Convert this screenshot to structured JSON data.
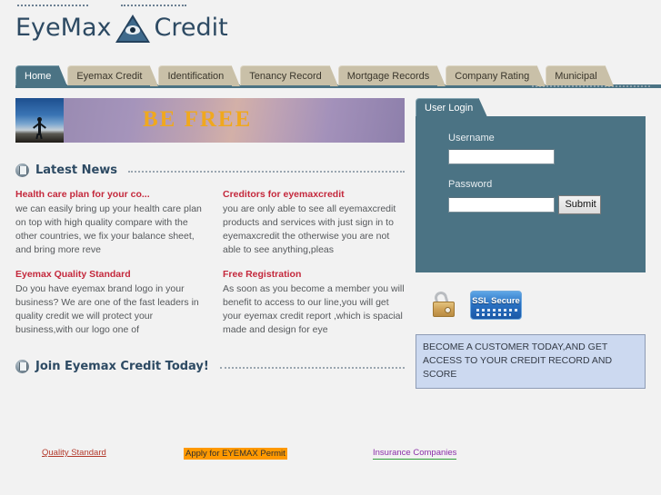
{
  "brand": {
    "word1": "EyeMax",
    "word2": "Credit",
    "logo_icon": "pyramid-eye-icon",
    "logo_color": "#2d4a63"
  },
  "nav": {
    "tabs": [
      {
        "label": "Home",
        "active": true
      },
      {
        "label": "Eyemax Credit",
        "active": false
      },
      {
        "label": "Identification",
        "active": false
      },
      {
        "label": "Tenancy Record",
        "active": false
      },
      {
        "label": "Mortgage Records",
        "active": false
      },
      {
        "label": "Company Rating",
        "active": false
      },
      {
        "label": "Municipal",
        "active": false
      }
    ],
    "active_color": "#4b7384",
    "inactive_color": "#c9c0a8"
  },
  "banner": {
    "text": "BE FREE",
    "text_color": "#f0a81e",
    "photo_alt": "person-arms-raised-silhouette"
  },
  "sections": {
    "latest_news_heading": "Latest News",
    "join_heading": "Join Eyemax Credit Today!"
  },
  "news": [
    {
      "title": "Health care plan for your co...",
      "body": "we can easily bring up your health care plan on top with high quality compare with the other countries, we fix your balance sheet, and bring more reve"
    },
    {
      "title": "Creditors for eyemaxcredit",
      "body": "you are only able to see all eyemaxcredit products and services with just sign in to eyemaxcredit the otherwise you are not able to see anything,pleas"
    },
    {
      "title": "Eyemax Quality Standard",
      "body": "Do you have eyemax brand logo in your business? We are one of the fast leaders in quality credit we will protect your business,with our logo one of"
    },
    {
      "title": "Free Registration",
      "body": "As soon as you become a member you will benefit to access to our line,you will get your eyemax credit report ,which is spacial made and design for eye"
    }
  ],
  "login": {
    "tab_label": "User Login",
    "username_label": "Username",
    "username_value": "",
    "username_placeholder": "",
    "password_label": "Password",
    "password_value": "",
    "password_placeholder": "",
    "submit_label": "Submit",
    "panel_color": "#4b7384"
  },
  "security": {
    "padlock_icon": "padlock-icon",
    "ssl_label": "SSL Secure",
    "ssl_badge_color": "#2a72c4"
  },
  "promo": {
    "text": "BECOME A CUSTOMER TODAY,AND GET ACCESS TO YOUR CREDIT RECORD AND SCORE",
    "background": "#ccd9f0"
  },
  "footer": {
    "links": [
      {
        "label": "Quality Standard",
        "color": "#b33a2c"
      },
      {
        "label": "Apply for EYEMAX Permit",
        "color": "#2f2f2f",
        "highlight": "#ff9900"
      },
      {
        "label": "Insurance Companies",
        "color": "#8b2fa8",
        "underline": "#2f9e3c"
      }
    ]
  }
}
